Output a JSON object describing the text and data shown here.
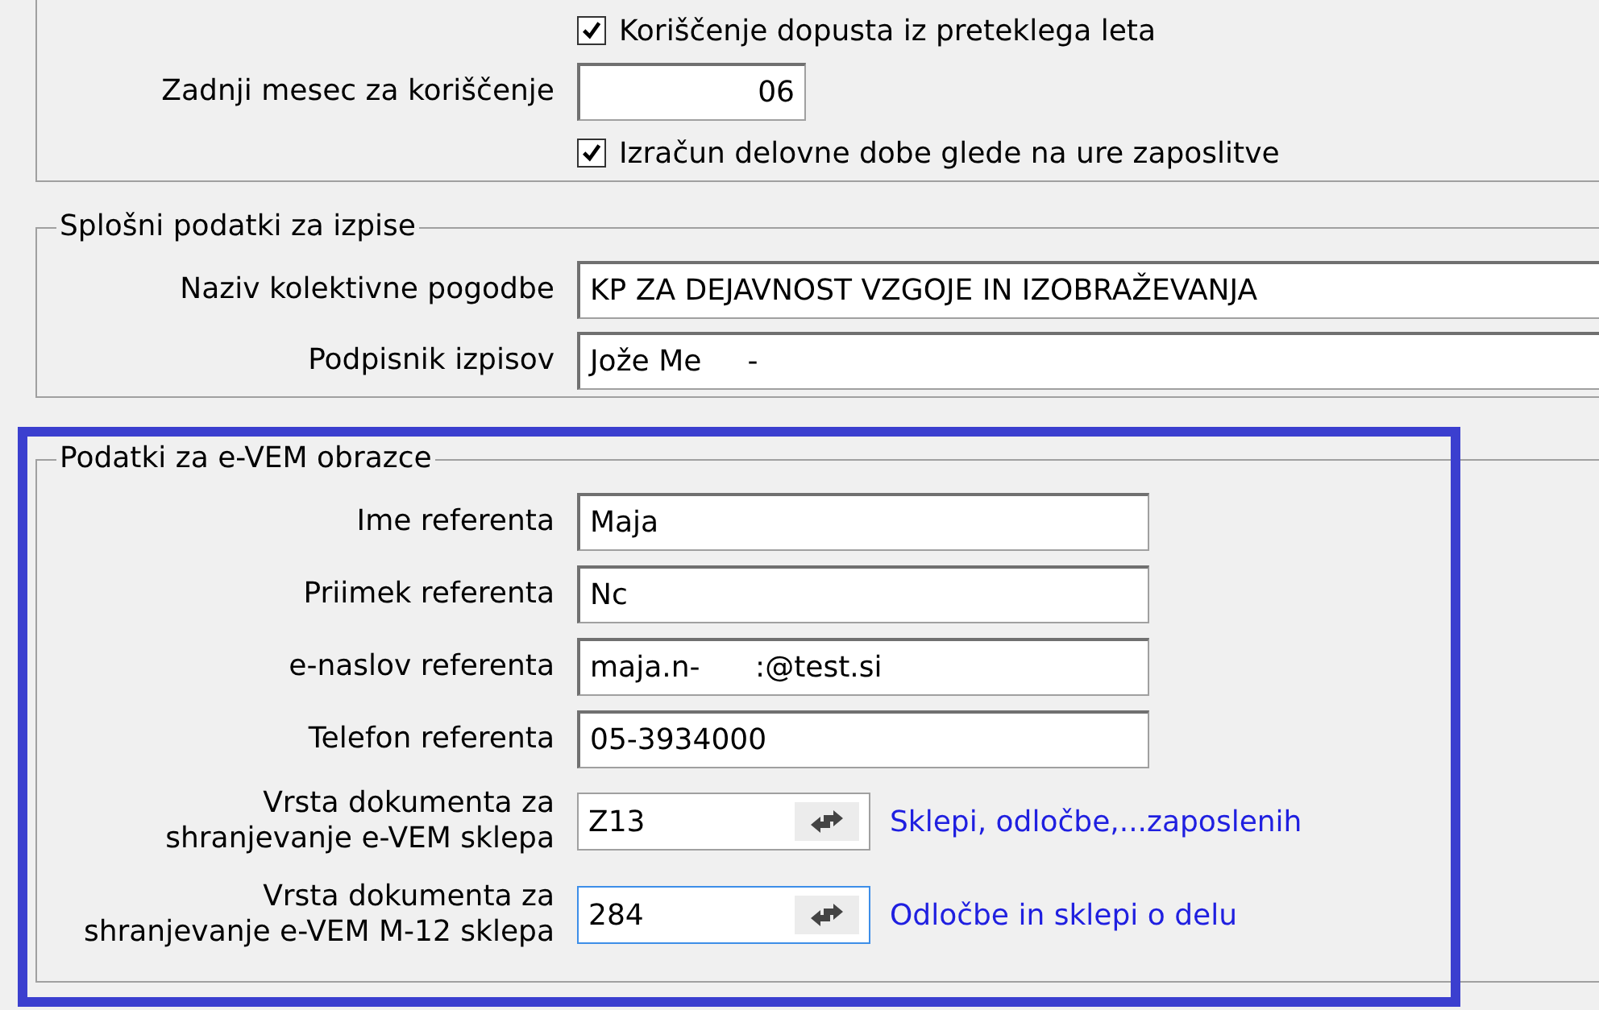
{
  "top_section": {
    "items": [
      {
        "kind": "checkbox",
        "label": "Koriščenje dopusta iz preteklega leta",
        "checked": true
      },
      {
        "kind": "field",
        "label": "Zadnji mesec za koriščenje",
        "value": "06"
      },
      {
        "kind": "checkbox",
        "label": "Izračun delovne dobe glede na ure zaposlitve",
        "checked": true
      }
    ]
  },
  "general": {
    "title": "Splošni podatki za izpise",
    "fields": [
      {
        "label": [
          "Naziv kolektivne pogodbe"
        ],
        "value": "KP ZA DEJAVNOST VZGOJE IN IZOBRAŽEVANJA"
      },
      {
        "label": [
          "Podpisnik izpisov"
        ],
        "value": "Jože Me     -"
      }
    ]
  },
  "evem": {
    "title": "Podatki za e-VEM obrazce",
    "highlighted": true,
    "fields": [
      {
        "kind": "text",
        "label": [
          "Ime referenta"
        ],
        "value": "Maja"
      },
      {
        "kind": "text",
        "label": [
          "Priimek referenta"
        ],
        "value": "Nc"
      },
      {
        "kind": "text",
        "label": [
          "e-naslov referenta"
        ],
        "value": "maja.n-      :@test.si"
      },
      {
        "kind": "text",
        "label": [
          "Telefon referenta"
        ],
        "value": "05-3934000"
      },
      {
        "kind": "lookup",
        "label": [
          "Vrsta dokumenta za",
          "shranjevanje e-VEM sklepa"
        ],
        "value": "Z13",
        "description": "Sklepi, odločbe,...zaposlenih",
        "focused": false
      },
      {
        "kind": "lookup",
        "label": [
          "Vrsta dokumenta za",
          "shranjevanje e-VEM M-12 sklepa"
        ],
        "value": "284",
        "description": "Odločbe in sklepi o delu",
        "focused": true
      }
    ]
  }
}
